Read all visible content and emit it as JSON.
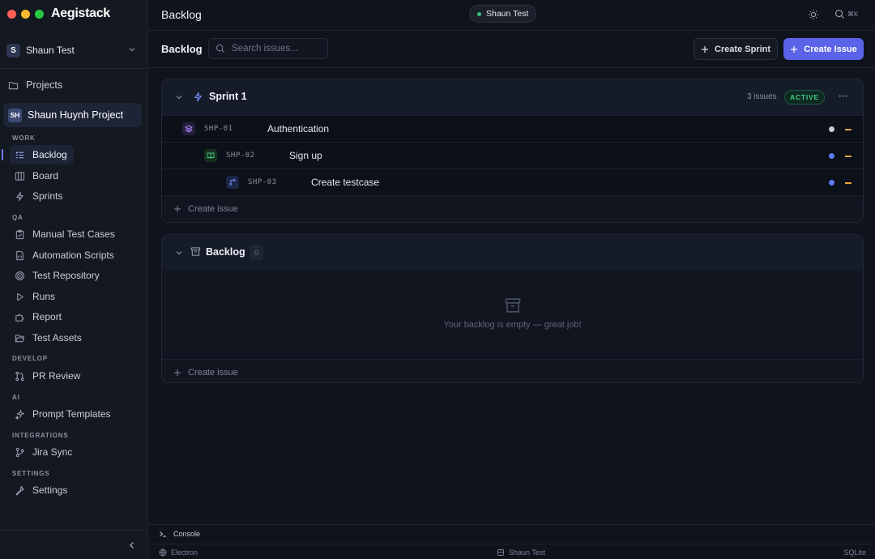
{
  "app": {
    "brand": "Aegistack"
  },
  "colors": {
    "accent": "#5b63e8",
    "active_green": "#3ed08a",
    "priority_orange": "#f0a33a",
    "status_gray": "#c8ccd6",
    "status_blue": "#5b7cf5"
  },
  "workspace": {
    "avatar": "S",
    "name": "Shaun Test"
  },
  "sidebar": {
    "projects_label": "Projects",
    "project": {
      "avatar": "SH",
      "name": "Shaun Huynh Project"
    },
    "sections": {
      "work": "WORK",
      "qa": "QA",
      "develop": "DEVELOP",
      "ai": "AI",
      "integrations": "INTEGRATIONS",
      "settings": "SETTINGS"
    },
    "items": {
      "backlog": "Backlog",
      "board": "Board",
      "sprints": "Sprints",
      "manual_test_cases": "Manual Test Cases",
      "automation_scripts": "Automation Scripts",
      "test_repository": "Test Repository",
      "runs": "Runs",
      "report": "Report",
      "test_assets": "Test Assets",
      "pr_review": "PR Review",
      "prompt_templates": "Prompt Templates",
      "jira_sync": "Jira Sync",
      "settings": "Settings"
    }
  },
  "topbar": {
    "title": "Backlog",
    "workspace_pill": "Shaun Test",
    "shortcut": "⌘K"
  },
  "subheader": {
    "title": "Backlog",
    "search_placeholder": "Search issues...",
    "create_sprint": "Create Sprint",
    "create_issue": "Create Issue"
  },
  "sprint": {
    "title": "Sprint 1",
    "issues_count": "3 issues",
    "status": "ACTIVE",
    "issues": [
      {
        "key": "SHP-01",
        "title": "Authentication",
        "type": "epic",
        "status": "gray"
      },
      {
        "key": "SHP-02",
        "title": "Sign up",
        "type": "story",
        "status": "blue"
      },
      {
        "key": "SHP-03",
        "title": "Create testcase",
        "type": "subtask",
        "status": "blue"
      }
    ],
    "create_issue": "Create issue"
  },
  "backlog": {
    "title": "Backlog",
    "count": "0",
    "empty_text": "Your backlog is empty — great job!",
    "create_issue": "Create issue"
  },
  "console": {
    "label": "Console"
  },
  "statusbar": {
    "left": "Electron",
    "middle": "Shaun Test",
    "right": "SQLite"
  }
}
